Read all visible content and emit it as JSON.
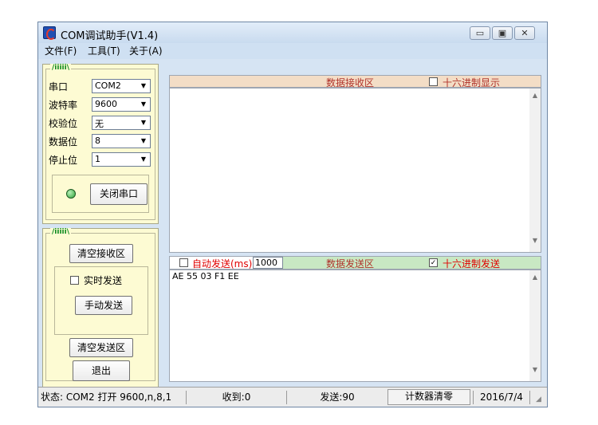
{
  "window": {
    "title": "COM调试助手(V1.4)",
    "caption_buttons": [
      {
        "name": "minimize-button",
        "glyph": "▭"
      },
      {
        "name": "maximize-button",
        "glyph": "▣"
      },
      {
        "name": "close-button",
        "glyph": "✕"
      }
    ]
  },
  "menu": [
    "文件(F)",
    "工具(T)",
    "关于(A)"
  ],
  "serial_group": {
    "title": "/iiiii\\",
    "fields": [
      {
        "label": "串口",
        "value": "COM2"
      },
      {
        "label": "波特率",
        "value": "9600"
      },
      {
        "label": "校验位",
        "value": "无"
      },
      {
        "label": "数据位",
        "value": "8"
      },
      {
        "label": "停止位",
        "value": "1"
      }
    ],
    "status_led_color": "#2ea33a",
    "toggle_button": "关闭串口"
  },
  "control_group": {
    "title": "/iiiii\\",
    "clear_receive": "清空接收区",
    "realtime_send": {
      "label": "实时发送",
      "checked": false
    },
    "manual_send": "手动发送",
    "clear_send": "清空发送区"
  },
  "exit_button": "退出",
  "receive": {
    "header": "数据接收区",
    "hex_display": {
      "label": "十六进制显示",
      "checked": false
    },
    "content": ""
  },
  "send": {
    "auto_send": {
      "label": "自动发送(ms)",
      "checked": false,
      "interval": "1000"
    },
    "header": "数据发送区",
    "hex_send": {
      "label": "十六进制发送",
      "checked": true
    },
    "content": "AE 55 03 F1 EE"
  },
  "statusbar": {
    "status": "状态: COM2 打开 9600,n,8,1",
    "received": "收到:0",
    "sent": "发送:90",
    "counter_reset": "计数器清零",
    "date": "2016/7/4"
  }
}
